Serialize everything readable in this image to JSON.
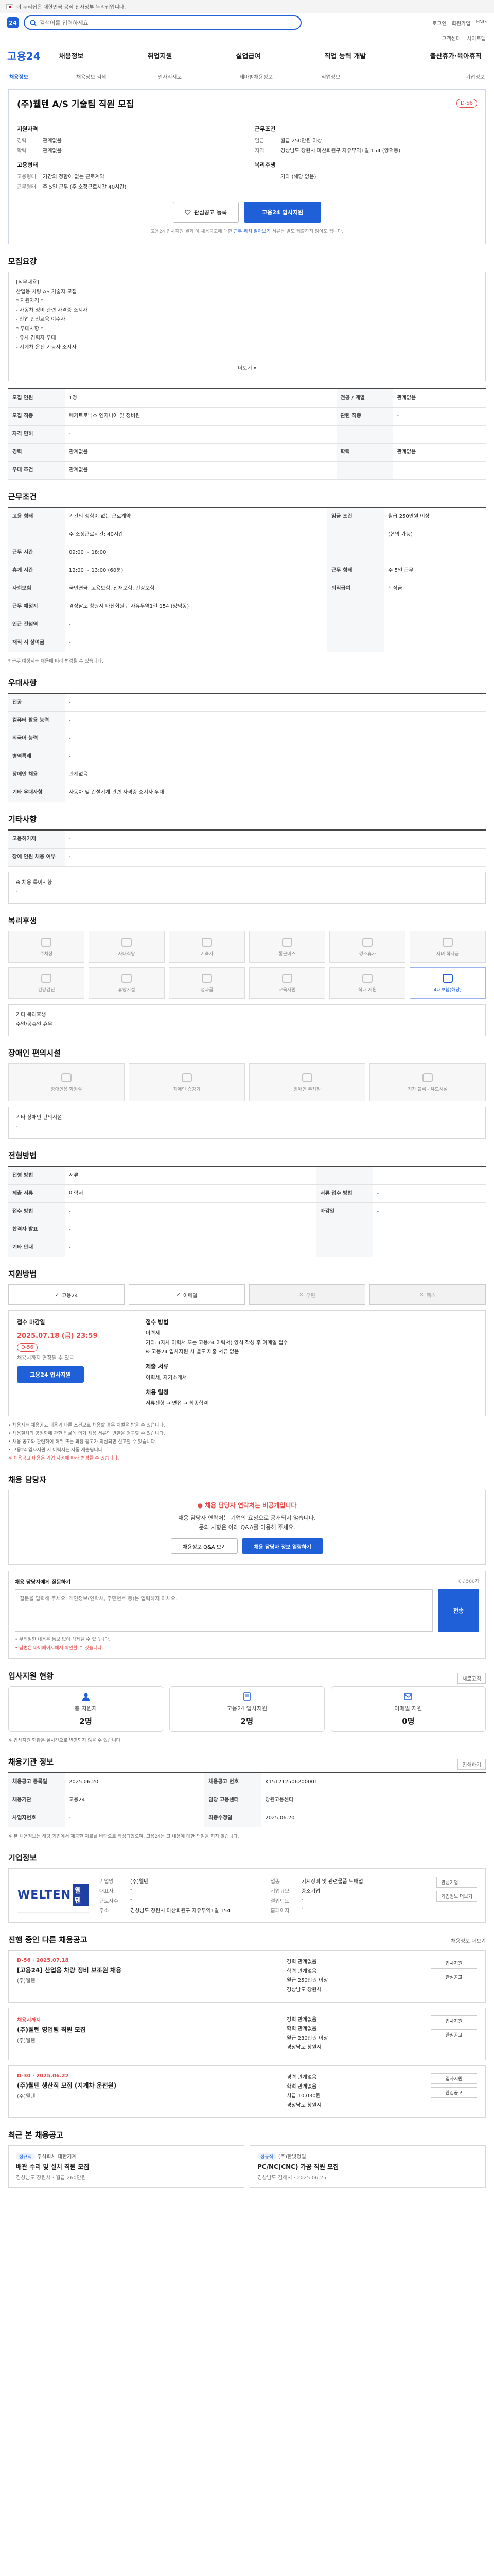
{
  "gov_banner": {
    "text": "이 누리집은 대한민국 공식 전자정부 누리집입니다."
  },
  "topbar": {
    "search_placeholder": "검색어를 입력하세요",
    "right_links": [
      "로그인",
      "회원가입",
      "ENG"
    ]
  },
  "util": [
    "고객센터",
    "사이트맵"
  ],
  "gnb": {
    "brand": "고용24",
    "menu": [
      "채용정보",
      "취업지원",
      "실업급여",
      "직업 능력 개발",
      "출산휴가·육아휴직"
    ]
  },
  "subnav": [
    "채용정보",
    "채용정보 검색",
    "일자리지도",
    "테마별채용정보",
    "직업정보",
    "기업정보"
  ],
  "header": {
    "title": "(주)웰텐 A/S 기술팀 직원 모집",
    "dday": "D-56",
    "company_h": "지원자격",
    "cond_h": "근무조건",
    "company": [
      {
        "k": "경력",
        "v": "관계없음"
      },
      {
        "k": "학력",
        "v": "관계없음"
      }
    ],
    "cond": [
      {
        "k": "임금",
        "v": "월급 250만원 이상"
      },
      {
        "k": "지역",
        "v": "경상남도 창원시 마산회원구 자유무역1길 154 (양덕동)"
      }
    ],
    "company_h2": "고용형태",
    "company2": [
      {
        "k": "고용형태",
        "v": "기간의 정함이 없는 근로계약"
      },
      {
        "k": "근무형태",
        "v": "주 5일 근무 (주 소정근로시간 40시간)"
      }
    ],
    "cond_h2": "복리후생",
    "cond2": [
      {
        "k": "",
        "v": "기타 (해당 없음)"
      }
    ],
    "btn_save": "관심공고 등록",
    "btn_apply": "고용24 입사지원",
    "notice_a": "고용24 입사지원 결과 이 채용공고에 대한",
    "notice_b": "근무 위치 알아보기",
    "notice_c": "서류는 별도 제출하지 않아도 됩니다."
  },
  "recruit_title": "모집요강",
  "job_desc": [
    "[직무내용]",
    "산업용 차량 AS 기술자 모집",
    "",
    "* 지원자격 *",
    "- 자동차 정비 관련 자격증 소지자",
    "- 산업 안전교육 이수자",
    "",
    "* 우대사항 *",
    "- 유사 경력자 우대",
    "- 지게차 운전 기능사 소지자"
  ],
  "job_desc_more": "더보기",
  "recruit_rows": [
    {
      "k": "모집 인원",
      "v": "1명",
      "k2": "전공 / 계열",
      "v2": "관계없음"
    },
    {
      "k": "모집 직종",
      "v": "메카트로닉스 엔지니어 및 정비원",
      "k2": "관련 직종",
      "v2": "-"
    },
    {
      "k": "자격 면허",
      "v": "-",
      "k2": "",
      "v2": ""
    },
    {
      "k": "경력",
      "v": "관계없음",
      "k2": "학력",
      "v2": "관계없음"
    },
    {
      "k": "우대 조건",
      "v": "관계없음",
      "k2": "",
      "v2": ""
    }
  ],
  "cond_title": "근무조건",
  "cond_rows": [
    {
      "k": "고용 형태",
      "v": "기간의 정함이 없는 근로계약",
      "k2": "임금 조건",
      "v2": "월급 250만원 이상"
    },
    {
      "k": "",
      "v": "주 소정근로시간: 40시간",
      "k2": "",
      "v2": "(협의 가능)"
    },
    {
      "k": "근무 시간",
      "v": "09:00 ~ 18:00",
      "k2": "",
      "v2": ""
    },
    {
      "k": "휴게 시간",
      "v": "12:00 ~ 13:00 (60분)",
      "k2": "근무 형태",
      "v2": "주 5일 근무"
    },
    {
      "k": "사회보험",
      "v": "국민연금, 고용보험, 산재보험, 건강보험",
      "k2": "퇴직급여",
      "v2": "퇴직금"
    },
    {
      "k": "근무 예정지",
      "v": "경상남도 창원시 마산회원구 자유무역1길 154 (양덕동)",
      "k2": "",
      "v2": ""
    },
    {
      "k": "인근 전철역",
      "v": "-",
      "k2": "",
      "v2": ""
    },
    {
      "k": "재직 시 상여금",
      "v": "-",
      "k2": "",
      "v2": ""
    }
  ],
  "cond_map_btn": "지도 보기",
  "cond_note": "* 근무 예정지는 채용에 따라 변경될 수 있습니다.",
  "req_title": "우대사항",
  "req_rows": [
    {
      "k": "전공",
      "v": "-"
    },
    {
      "k": "컴퓨터 활용 능력",
      "v": "-"
    },
    {
      "k": "외국어 능력",
      "v": "-"
    },
    {
      "k": "병역특례",
      "v": "-"
    },
    {
      "k": "장애인 채용",
      "v": "관계없음"
    },
    {
      "k": "기타 우대사항",
      "v": "자동차 및 건설기계 관련 자격증 소지자 우대"
    }
  ],
  "etc_title": "기타사항",
  "etc_rows": [
    {
      "k": "고용허가제",
      "v": "-"
    },
    {
      "k": "장애 인원 채용 여부",
      "v": "-"
    }
  ],
  "etc_memo": "※ 채용 특이사항",
  "etc_memo2": "-",
  "welfare_title": "복리후생",
  "welfare": [
    {
      "n": "주차장",
      "on": false
    },
    {
      "n": "사내식당",
      "on": false
    },
    {
      "n": "기숙사",
      "on": false
    },
    {
      "n": "통근버스",
      "on": false
    },
    {
      "n": "경조휴가",
      "on": false
    },
    {
      "n": "자녀 학자금",
      "on": false
    },
    {
      "n": "건강검진",
      "on": false
    },
    {
      "n": "휴양시설",
      "on": false
    },
    {
      "n": "성과급",
      "on": false
    },
    {
      "n": "교육지원",
      "on": false
    },
    {
      "n": "식대 지원",
      "on": false
    },
    {
      "n": "4대보험(해당)",
      "on": true
    }
  ],
  "welfare_memo": "기타 복리후생",
  "welfare_memo2": "주말/공휴일 휴무",
  "disabled_title": "장애인 편의시설",
  "disabled": [
    {
      "n": "장애인용 화장실"
    },
    {
      "n": "장애인 승강기"
    },
    {
      "n": "장애인 주차장"
    },
    {
      "n": "점자 블록 · 유도시설"
    }
  ],
  "disabled_memo": "기타 장애인 편의시설",
  "disabled_memo2": "-",
  "process_title": "전형방법",
  "process_rows": [
    {
      "k": "전형 방법",
      "v": "서류",
      "k2": "",
      "v2": ""
    },
    {
      "k": "제출 서류",
      "v": "이력서",
      "k2": "서류 접수 방법",
      "v2": "-"
    },
    {
      "k": "접수 방법",
      "v": "-",
      "k2": "마감일",
      "v2": "-"
    },
    {
      "k": "합격자 발표",
      "v": "-",
      "k2": "",
      "v2": ""
    },
    {
      "k": "기타 안내",
      "v": "-",
      "k2": "",
      "v2": ""
    }
  ],
  "apply_title": "지원방법",
  "apply_methods": [
    {
      "n": "고용24",
      "on": true
    },
    {
      "n": "이메일",
      "on": true
    },
    {
      "n": "우편",
      "on": false
    },
    {
      "n": "팩스",
      "on": false
    }
  ],
  "deadline": {
    "label": "접수 마감일",
    "date": "2025.07.18 (금) 23:59",
    "dday": "D-56",
    "small": "채용시까지 연장될 수 있음",
    "btn": "고용24 입사지원",
    "r_label": "접수 방법",
    "r_lines": [
      "이력서",
      "기타: (자사 이력서 또는 고용24 이력서) 양식 작성 후 이메일 접수",
      "※ 고용24 입사지원 시 별도 제출 서류 없음"
    ],
    "r_label2": "제출 서류",
    "r_line2": "이력서, 자기소개서",
    "r_label3": "채용 일정",
    "r_line3": "서류전형 → 면접 → 최종합격"
  },
  "apply_notes": [
    "• 채용자는 채용공고 내용과 다른 조건으로 채용할 경우 처벌을 받을 수 있습니다.",
    "• 채용절차의 공정화에 관한 법률에 의거 채용 서류의 반환을 청구할 수 있습니다.",
    "• 채용 공고와 관련하여 허위 또는 과장 광고가 의심되면 신고할 수 있습니다.",
    "• 고용24 입사지원 시 이력서는 자동 제출됩니다."
  ],
  "apply_notes_red": "※ 채용공고 내용은 기업 사정에 따라 변경될 수 있습니다.",
  "manager_title": "채용 담당자",
  "manager": {
    "warn": "채용 담당자 연락처는 비공개입니다",
    "t1": "채용 담당자 연락처는 기업의 요청으로 공개되지 않습니다.",
    "t2": "문의 사항은 아래 Q&A를 이용해 주세요.",
    "btn1": "채용정보 Q&A 보기",
    "btn2": "채용 담당자 정보 열람하기"
  },
  "qa": {
    "head": "채용 담당자에게 질문하기",
    "count": "0 / 500자",
    "placeholder": "질문을 입력해 주세요. 개인정보(연락처, 주민번호 등)는 입력하지 마세요.",
    "send": "전송",
    "foot1": "• 부적절한 내용은 통보 없이 삭제될 수 있습니다.",
    "foot2": "• 답변은 마이페이지에서 확인할 수 있습니다."
  },
  "stats_title": "입사지원 현황",
  "stats_more": "새로고침",
  "stats": [
    {
      "n": "총 지원자",
      "c": "2명"
    },
    {
      "n": "고용24 입사지원",
      "c": "2명"
    },
    {
      "n": "이메일 지원",
      "c": "0명"
    }
  ],
  "stats_note": "※ 입사지원 현황은 실시간으로 반영되지 않을 수 있습니다.",
  "info_title": "채용기관 정보",
  "info_print": "인쇄하기",
  "info_rows": [
    {
      "k": "채용공고 등록일",
      "v": "2025.06.20",
      "k2": "채용공고 번호",
      "v2": "K151212506200001"
    },
    {
      "k": "채용기관",
      "v": "고용24",
      "k2": "담당 고용센터",
      "v2": "창원고용센터"
    },
    {
      "k": "사업자번호",
      "v": "-",
      "k2": "최종수정일",
      "v2": "2025.06.20"
    }
  ],
  "info_note": "※ 본 채용정보는 해당 기업에서 제공한 자료를 바탕으로 작성되었으며, 고용24는 그 내용에 대한 책임을 지지 않습니다.",
  "company_title": "기업정보",
  "company_logo": "WELTEN",
  "company_logo_badge": "웰텐",
  "company_info": [
    {
      "k": "기업명",
      "v": "(주)웰텐"
    },
    {
      "k": "업종",
      "v": "기계장비 및 관련물품 도매업"
    },
    {
      "k": "대표자",
      "v": "-"
    },
    {
      "k": "기업규모",
      "v": "중소기업"
    },
    {
      "k": "근로자수",
      "v": "-"
    },
    {
      "k": "설립년도",
      "v": "-"
    },
    {
      "k": "주소",
      "v": "경상남도 창원시 마산회원구 자유무역1길 154"
    },
    {
      "k": "홈페이지",
      "v": "-"
    }
  ],
  "company_side": [
    "관심기업",
    "기업정보 더보기"
  ],
  "other_title": "진행 중인 다른 채용공고",
  "other_more": "채용정보 더보기",
  "jobs": [
    {
      "date": "D-56 · 2025.07.18",
      "ttl": "[고용24] 산업용 차량 정비 보조원 채용",
      "co": "(주)웰텐",
      "m1": "경력 관계없음",
      "m2": "학력 관계없음",
      "m3": "월급 250만원 이상",
      "m4": "경상남도 창원시",
      "b1": "입사지원",
      "b2": "관심공고"
    },
    {
      "date": "채용시까지",
      "ttl": "(주)웰텐 영업팀 직원 모집",
      "co": "(주)웰텐",
      "m1": "경력 관계없음",
      "m2": "학력 관계없음",
      "m3": "월급 230만원 이상",
      "m4": "경상남도 창원시",
      "b1": "입사지원",
      "b2": "관심공고"
    },
    {
      "date": "D-30 · 2025.06.22",
      "ttl": "(주)웰텐 생산직 모집 (지게차 운전원)",
      "co": "(주)웰텐",
      "m1": "경력 관계없음",
      "m2": "학력 관계없음",
      "m3": "시급 10,030원",
      "m4": "경상남도 창원시",
      "b1": "입사지원",
      "b2": "관심공고"
    }
  ],
  "recent_title": "최근 본 채용공고",
  "recent": [
    {
      "tag": "정규직",
      "co": "주식회사 대한기계",
      "ttl": "배관 수리 및 설치 직원 모집",
      "mt": "경상남도 창원시 · 월급 260만원"
    },
    {
      "tag": "정규직",
      "co": "(주)한빛정밀",
      "ttl": "PC/NC(CNC) 가공 직원 모집",
      "mt": "경상남도 김해시 · 2025.06.25"
    }
  ]
}
